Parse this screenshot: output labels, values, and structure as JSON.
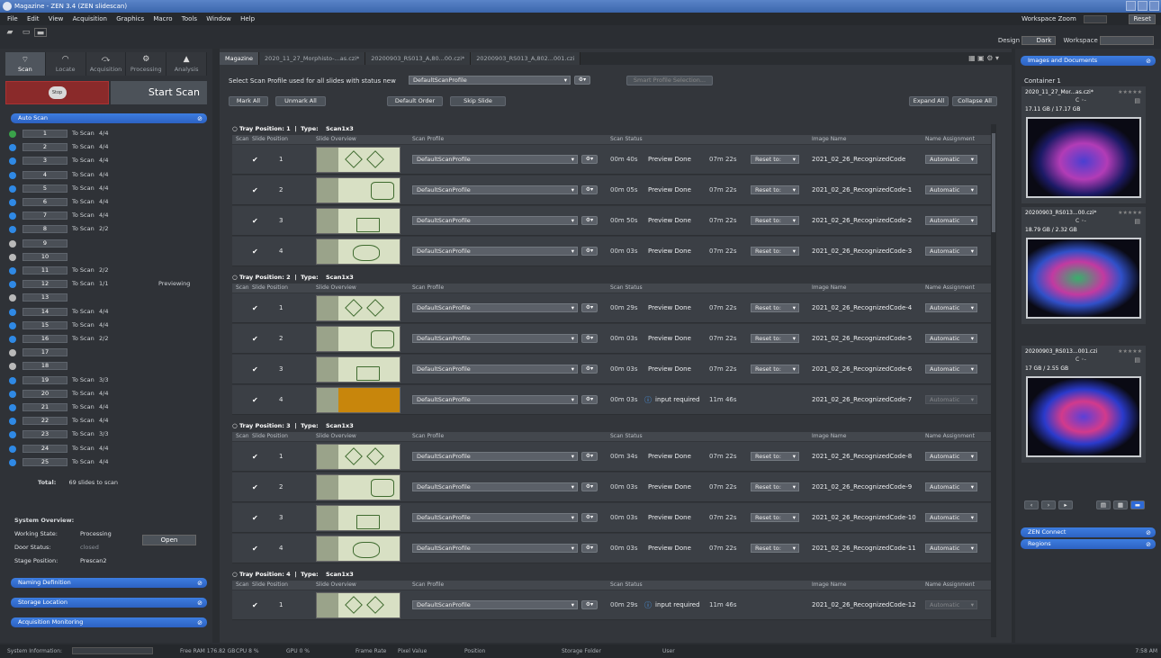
{
  "window": {
    "title": "Magazine - ZEN 3.4 (ZEN slidescan)"
  },
  "menu": {
    "items": [
      "File",
      "Edit",
      "View",
      "Acquisition",
      "Graphics",
      "Macro",
      "Tools",
      "Window",
      "Help"
    ]
  },
  "workspace": {
    "zoom_label": "Workspace Zoom",
    "reset_label": "Reset",
    "design_label": "Design",
    "design_value": "Dark",
    "workspace_label": "Workspace"
  },
  "left": {
    "tabs": [
      "Scan",
      "Locate",
      "Acquisition",
      "Processing",
      "Analysis"
    ],
    "stop_label": "Stop",
    "start_label": "Start Scan",
    "autoscan_title": "Auto Scan",
    "trays": [
      {
        "num": "1",
        "state": "To Scan",
        "count": "4/4",
        "extra": "",
        "color": "#3aa24a"
      },
      {
        "num": "2",
        "state": "To Scan",
        "count": "4/4",
        "extra": "",
        "color": "#2f89e5"
      },
      {
        "num": "3",
        "state": "To Scan",
        "count": "4/4",
        "extra": "",
        "color": "#2f89e5"
      },
      {
        "num": "4",
        "state": "To Scan",
        "count": "4/4",
        "extra": "",
        "color": "#2f89e5"
      },
      {
        "num": "5",
        "state": "To Scan",
        "count": "4/4",
        "extra": "",
        "color": "#2f89e5"
      },
      {
        "num": "6",
        "state": "To Scan",
        "count": "4/4",
        "extra": "",
        "color": "#2f89e5"
      },
      {
        "num": "7",
        "state": "To Scan",
        "count": "4/4",
        "extra": "",
        "color": "#2f89e5"
      },
      {
        "num": "8",
        "state": "To Scan",
        "count": "2/2",
        "extra": "",
        "color": "#2f89e5"
      },
      {
        "num": "9",
        "state": "",
        "count": "",
        "extra": "",
        "color": "#b9b9b9"
      },
      {
        "num": "10",
        "state": "",
        "count": "",
        "extra": "",
        "color": "#b9b9b9"
      },
      {
        "num": "11",
        "state": "To Scan",
        "count": "2/2",
        "extra": "",
        "color": "#2f89e5"
      },
      {
        "num": "12",
        "state": "To Scan",
        "count": "1/1",
        "extra": "Previewing",
        "color": "#2f89e5"
      },
      {
        "num": "13",
        "state": "",
        "count": "",
        "extra": "",
        "color": "#b9b9b9"
      },
      {
        "num": "14",
        "state": "To Scan",
        "count": "4/4",
        "extra": "",
        "color": "#2f89e5"
      },
      {
        "num": "15",
        "state": "To Scan",
        "count": "4/4",
        "extra": "",
        "color": "#2f89e5"
      },
      {
        "num": "16",
        "state": "To Scan",
        "count": "2/2",
        "extra": "",
        "color": "#2f89e5"
      },
      {
        "num": "17",
        "state": "",
        "count": "",
        "extra": "",
        "color": "#b9b9b9"
      },
      {
        "num": "18",
        "state": "",
        "count": "",
        "extra": "",
        "color": "#b9b9b9"
      },
      {
        "num": "19",
        "state": "To Scan",
        "count": "3/3",
        "extra": "",
        "color": "#2f89e5"
      },
      {
        "num": "20",
        "state": "To Scan",
        "count": "4/4",
        "extra": "",
        "color": "#2f89e5"
      },
      {
        "num": "21",
        "state": "To Scan",
        "count": "4/4",
        "extra": "",
        "color": "#2f89e5"
      },
      {
        "num": "22",
        "state": "To Scan",
        "count": "4/4",
        "extra": "",
        "color": "#2f89e5"
      },
      {
        "num": "23",
        "state": "To Scan",
        "count": "3/3",
        "extra": "",
        "color": "#2f89e5"
      },
      {
        "num": "24",
        "state": "To Scan",
        "count": "4/4",
        "extra": "",
        "color": "#2f89e5"
      },
      {
        "num": "25",
        "state": "To Scan",
        "count": "4/4",
        "extra": "",
        "color": "#2f89e5"
      }
    ],
    "total_label": "Total:",
    "total_value": "69 slides to scan",
    "system": {
      "title": "System Overview:",
      "working_label": "Working State:",
      "working_value": "Processing",
      "door_label": "Door Status:",
      "door_value": "closed",
      "stage_label": "Stage Position:",
      "stage_value": "Prescan2",
      "open_label": "Open"
    },
    "sections": [
      "Naming Definition",
      "Storage Location",
      "Acquisition Monitoring"
    ]
  },
  "center": {
    "tabs": [
      "Magazine",
      "2020_11_27_Morphisto-...as.czi*",
      "20200903_RS013_A,80...00.czi*",
      "20200903_RS013_A,802...001.czi"
    ],
    "profile_label": "Select Scan Profile used for all slides with status new",
    "profile_value": "DefaultScanProfile",
    "smart_label": "Smart Profile Selection...",
    "buttons": {
      "mark_all": "Mark All",
      "unmark_all": "Unmark All",
      "default_order": "Default Order",
      "skip_slide": "Skip Slide",
      "expand_all": "Expand All",
      "collapse_all": "Collapse All"
    },
    "columns": [
      "Scan",
      "Slide Position",
      "Slide Overview",
      "Scan Profile",
      "Scan Status",
      "Image Name",
      "Name Assignment"
    ],
    "type_label": "Type:",
    "tray_label": "Tray Position:",
    "trays": [
      {
        "position": "1",
        "type": "Scan1x3",
        "rows": [
          {
            "pos": "1",
            "time": "00m 40s",
            "status": "Preview Done",
            "dur": "07m 22s",
            "name": "2021_02_26_RecognizedCode"
          },
          {
            "pos": "2",
            "time": "00m 05s",
            "status": "Preview Done",
            "dur": "07m 22s",
            "name": "2021_02_26_RecognizedCode-1"
          },
          {
            "pos": "3",
            "time": "00m 50s",
            "status": "Preview Done",
            "dur": "07m 22s",
            "name": "2021_02_26_RecognizedCode-2"
          },
          {
            "pos": "4",
            "time": "00m 03s",
            "status": "Preview Done",
            "dur": "07m 22s",
            "name": "2021_02_26_RecognizedCode-3"
          }
        ]
      },
      {
        "position": "2",
        "type": "Scan1x3",
        "rows": [
          {
            "pos": "1",
            "time": "00m 29s",
            "status": "Preview Done",
            "dur": "07m 22s",
            "name": "2021_02_26_RecognizedCode-4"
          },
          {
            "pos": "2",
            "time": "00m 03s",
            "status": "Preview Done",
            "dur": "07m 22s",
            "name": "2021_02_26_RecognizedCode-5"
          },
          {
            "pos": "3",
            "time": "00m 03s",
            "status": "Preview Done",
            "dur": "07m 22s",
            "name": "2021_02_26_RecognizedCode-6"
          },
          {
            "pos": "4",
            "time": "00m 03s",
            "status": "input required",
            "dur": "11m 46s",
            "name": "2021_02_26_RecognizedCode-7"
          }
        ]
      },
      {
        "position": "3",
        "type": "Scan1x3",
        "rows": [
          {
            "pos": "1",
            "time": "00m 34s",
            "status": "Preview Done",
            "dur": "07m 22s",
            "name": "2021_02_26_RecognizedCode-8"
          },
          {
            "pos": "2",
            "time": "00m 03s",
            "status": "Preview Done",
            "dur": "07m 22s",
            "name": "2021_02_26_RecognizedCode-9"
          },
          {
            "pos": "3",
            "time": "00m 03s",
            "status": "Preview Done",
            "dur": "07m 22s",
            "name": "2021_02_26_RecognizedCode-10"
          },
          {
            "pos": "4",
            "time": "00m 03s",
            "status": "Preview Done",
            "dur": "07m 22s",
            "name": "2021_02_26_RecognizedCode-11"
          }
        ]
      },
      {
        "position": "4",
        "type": "Scan1x3",
        "rows": [
          {
            "pos": "1",
            "time": "00m 29s",
            "status": "input required",
            "dur": "11m 46s",
            "name": "2021_02_26_RecognizedCode-12"
          }
        ]
      }
    ],
    "row_profile": "DefaultScanProfile",
    "reset_label": "Reset to:",
    "assign_label": "Automatic"
  },
  "right": {
    "panel_title": "Images and Documents",
    "container": "Container 1",
    "docs": [
      {
        "name": "2020_11_27_Mor...as.czi*",
        "size": "17.11 GB / 17.17 GB"
      },
      {
        "name": "20200903_RS013...00.czi*",
        "size": "18.79 GB / 2.32 GB"
      },
      {
        "name": "20200903_RS013...001.czi",
        "size": "17 GB / 2.55 GB"
      }
    ],
    "bottom": [
      "ZEN Connect",
      "Regions"
    ]
  },
  "status": {
    "info": "System Information:",
    "ram": "Free RAM 176.82 GB",
    "cpu": "CPU 8 %",
    "gpu": "GPU 0 %",
    "frame": "Frame Rate",
    "pixel": "Pixel Value",
    "position": "Position",
    "storage": "Storage Folder",
    "user": "User",
    "time": "7:58 AM"
  }
}
